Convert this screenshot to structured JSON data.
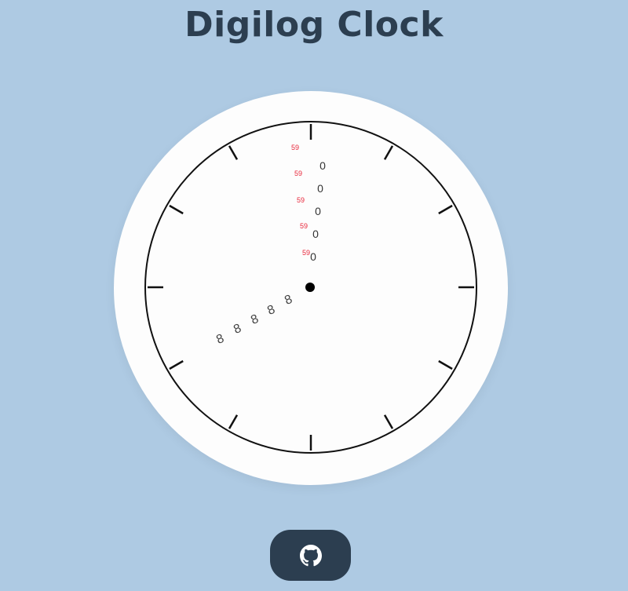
{
  "header": {
    "title": "Digilog Clock"
  },
  "clock": {
    "hour_digits": [
      "8",
      "8",
      "8",
      "8",
      "8"
    ],
    "minute_digits": [
      "0",
      "0",
      "0",
      "0",
      "0"
    ],
    "second_digits": [
      "59",
      "59",
      "59",
      "59",
      "59"
    ],
    "colors": {
      "hour": "#444444",
      "minute": "#333333",
      "second": "#e8283c",
      "face": "#fdfdfd",
      "ring": "#111111"
    }
  },
  "footer": {
    "github_icon": "github-icon"
  }
}
